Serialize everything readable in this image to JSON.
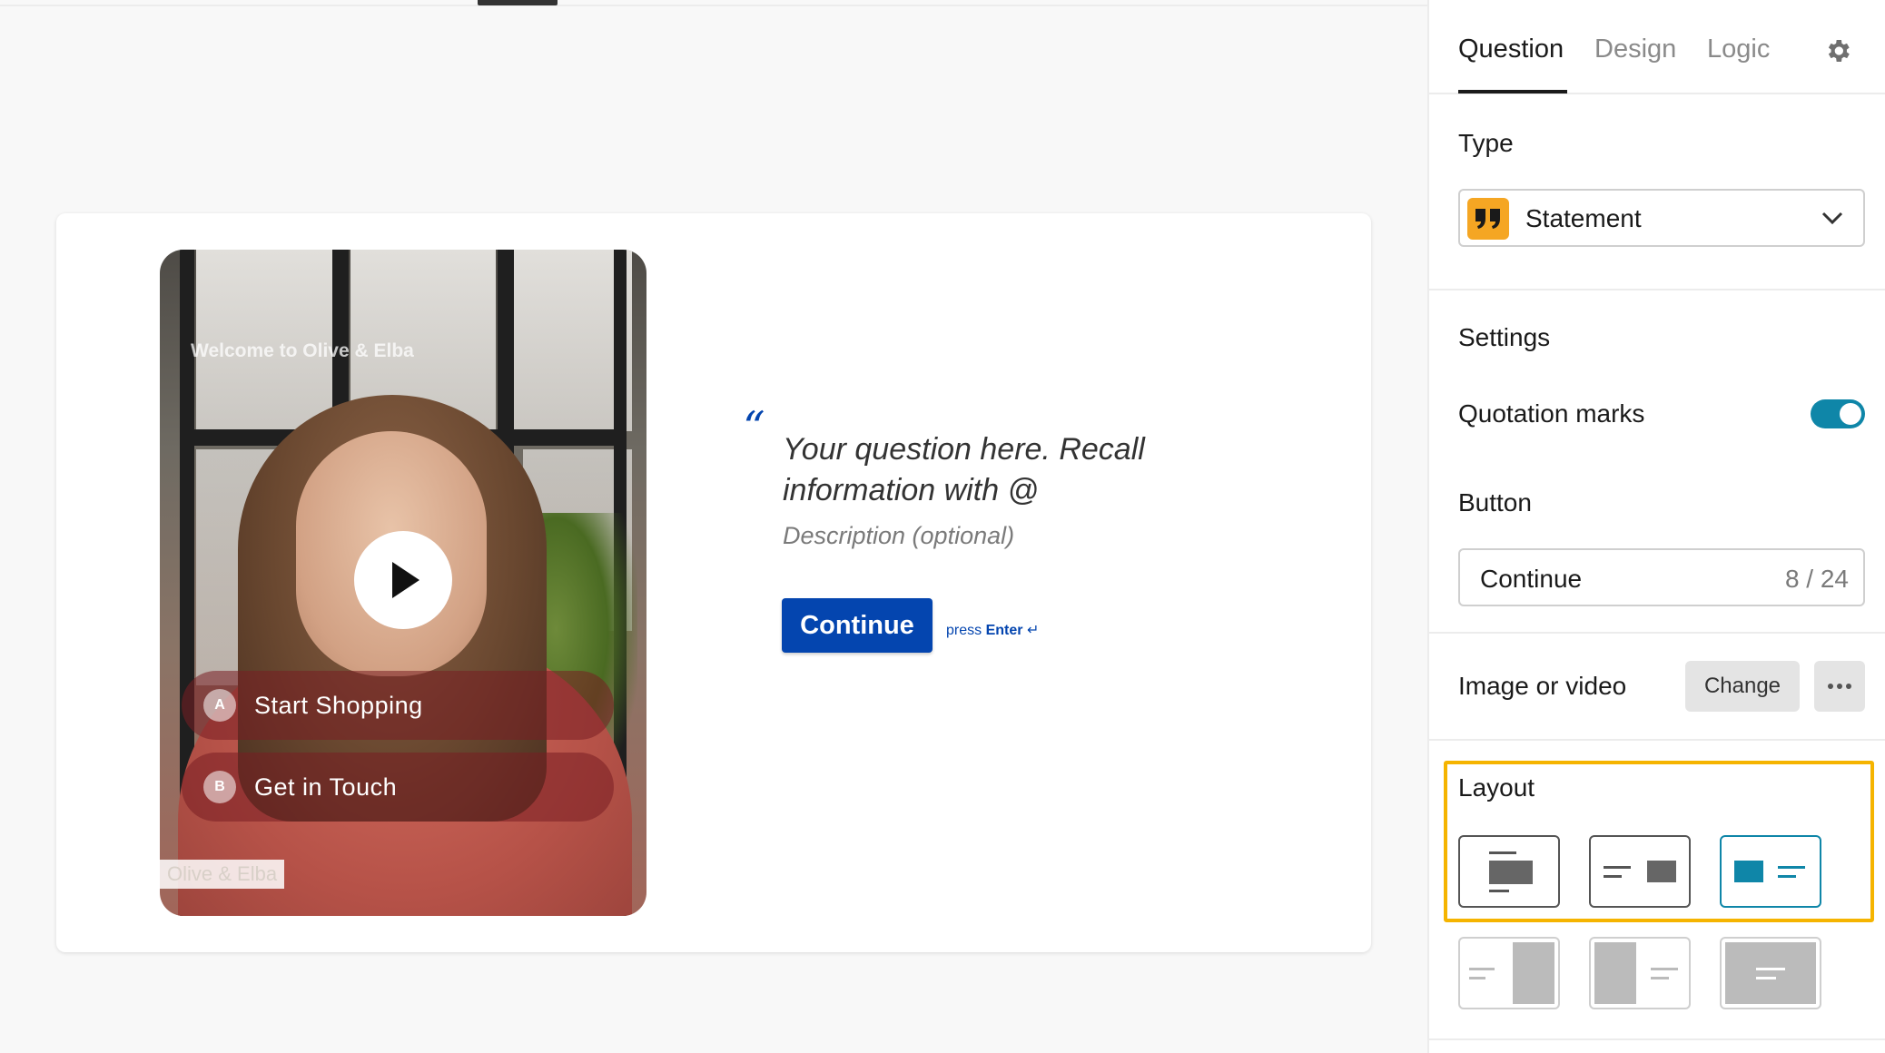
{
  "media": {
    "overlay_title": "Welcome to Olive & Elba",
    "choices": [
      {
        "key": "A",
        "label": "Start Shopping"
      },
      {
        "key": "B",
        "label": "Get in Touch"
      }
    ],
    "brand": "Olive & Elba"
  },
  "question": {
    "quote_mark": "“",
    "text": "Your question here. Recall information with @",
    "description": "Description (optional)",
    "button_label": "Continue",
    "press_prefix": "press ",
    "press_key": "Enter",
    "press_icon": "↵"
  },
  "panel": {
    "tabs": [
      {
        "label": "Question",
        "active": true
      },
      {
        "label": "Design",
        "active": false
      },
      {
        "label": "Logic",
        "active": false
      }
    ],
    "type": {
      "label": "Type",
      "value": "Statement",
      "icon": "quote-icon",
      "icon_color": "#f5a623"
    },
    "settings": {
      "label": "Settings",
      "quotation_marks": {
        "label": "Quotation marks",
        "enabled": true
      },
      "button": {
        "label": "Button",
        "value": "Continue",
        "count": "8 / 24"
      }
    },
    "image_or_video": {
      "label": "Image or video",
      "change_label": "Change"
    },
    "layout": {
      "label": "Layout",
      "selected": "media-left-text-right",
      "options": [
        "text-above-media",
        "text-left-media-right",
        "media-left-text-right",
        "text-left-media-split",
        "media-left-split",
        "media-full-background"
      ]
    }
  },
  "colors": {
    "accent_blue": "#0445af",
    "toggle_teal": "#0f86a8",
    "highlight_yellow": "#f5b400"
  }
}
